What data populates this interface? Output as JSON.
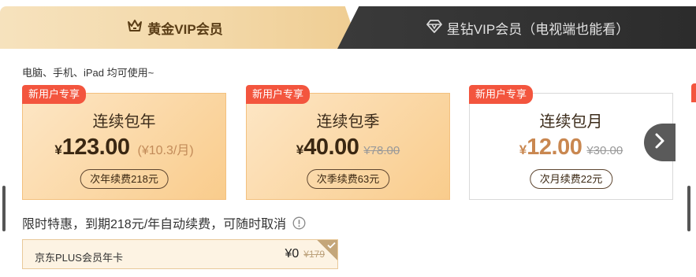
{
  "tabs": {
    "gold": {
      "label": "黄金VIP会员",
      "icon": "crown-icon"
    },
    "star": {
      "label": "星钻VIP会员（电视端也能看）",
      "icon": "diamond-icon"
    }
  },
  "subtitle": "电脑、手机、iPad 均可使用~",
  "plans": [
    {
      "badge": "新用户专享",
      "name": "连续包年",
      "currency": "¥",
      "price": "123.00",
      "per_month": "(¥10.3/月)",
      "original": "",
      "renew": "次年续费218元"
    },
    {
      "badge": "新用户专享",
      "name": "连续包季",
      "currency": "¥",
      "price": "40.00",
      "per_month": "",
      "original": "¥78.00",
      "renew": "次季续费63元"
    },
    {
      "badge": "新用户专享",
      "name": "连续包月",
      "currency": "¥",
      "price": "12.00",
      "per_month": "",
      "original": "¥30.00",
      "renew": "次月续费22元"
    }
  ],
  "notice": "限时特惠，到期218元/年自动续费，可随时取消",
  "bundle": {
    "name": "京东PLUS会员年卡",
    "price": "¥0",
    "original": "¥179"
  },
  "colors": {
    "badge": "#f3553e",
    "gold_tab": "#f3d8a8",
    "dark_tab": "#2e2e2e",
    "price_brown": "#c98750"
  }
}
